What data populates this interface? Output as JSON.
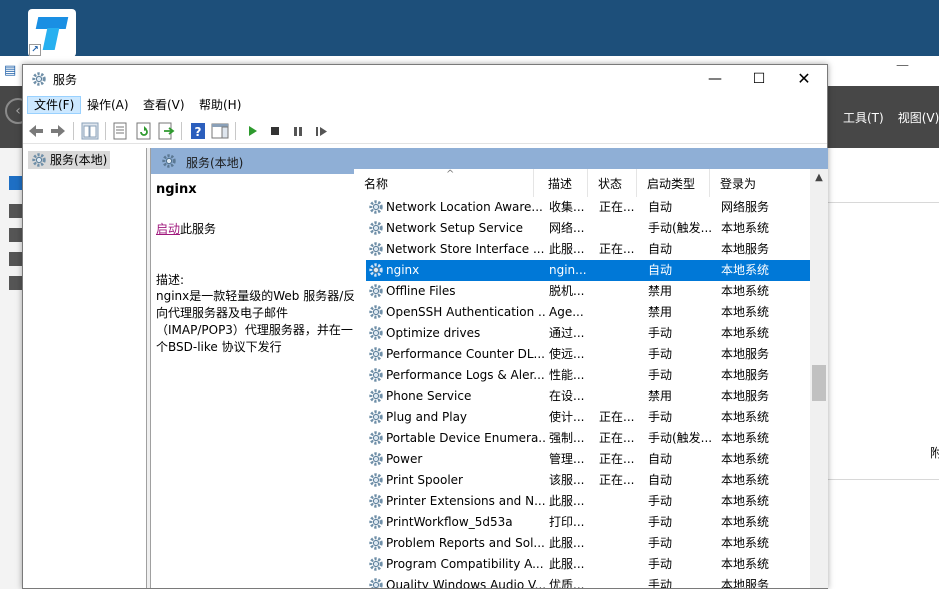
{
  "desktop": {
    "shortcut_icon": "app-shortcut-icon"
  },
  "background_app": {
    "menu": [
      "工具(T)",
      "视图(V)"
    ],
    "right_char": "附"
  },
  "window": {
    "title": "服务",
    "controls": {
      "minimize": "—",
      "maximize": "☐",
      "close": "✕"
    },
    "menu": [
      "文件(F)",
      "操作(A)",
      "查看(V)",
      "帮助(H)"
    ],
    "active_menu_index": 0,
    "toolbar_icons": [
      "back-arrow-icon",
      "forward-arrow-icon",
      "show-hide-console-tree-icon",
      "properties-icon",
      "refresh-icon",
      "export-list-icon",
      "help-icon",
      "action-pane-icon",
      "start-service-icon",
      "stop-service-icon",
      "pause-service-icon",
      "restart-service-icon"
    ]
  },
  "tree": {
    "item": "服务(本地)"
  },
  "main": {
    "header": "服务(本地)",
    "description": {
      "service_name": "nginx",
      "action_link": "启动",
      "action_suffix": "此服务",
      "label": "描述:",
      "text": "nginx是一款轻量级的Web 服务器/反向代理服务器及电子邮件（IMAP/POP3）代理服务器，并在一个BSD-like 协议下发行"
    },
    "columns": [
      "名称",
      "描述",
      "状态",
      "启动类型",
      "登录为"
    ],
    "rows": [
      {
        "name": "Network Location Aware...",
        "desc": "收集...",
        "status": "正在...",
        "start": "自动",
        "logon": "网络服务"
      },
      {
        "name": "Network Setup Service",
        "desc": "网络...",
        "status": "",
        "start": "手动(触发...",
        "logon": "本地系统"
      },
      {
        "name": "Network Store Interface ...",
        "desc": "此服...",
        "status": "正在...",
        "start": "自动",
        "logon": "本地服务"
      },
      {
        "name": "nginx",
        "desc": "ngin...",
        "status": "",
        "start": "自动",
        "logon": "本地系统",
        "selected": true
      },
      {
        "name": "Offline Files",
        "desc": "脱机...",
        "status": "",
        "start": "禁用",
        "logon": "本地系统"
      },
      {
        "name": "OpenSSH Authentication ...",
        "desc": "Age...",
        "status": "",
        "start": "禁用",
        "logon": "本地系统"
      },
      {
        "name": "Optimize drives",
        "desc": "通过...",
        "status": "",
        "start": "手动",
        "logon": "本地系统"
      },
      {
        "name": "Performance Counter DL...",
        "desc": "使远...",
        "status": "",
        "start": "手动",
        "logon": "本地服务"
      },
      {
        "name": "Performance Logs & Aler...",
        "desc": "性能...",
        "status": "",
        "start": "手动",
        "logon": "本地服务"
      },
      {
        "name": "Phone Service",
        "desc": "在设...",
        "status": "",
        "start": "禁用",
        "logon": "本地服务"
      },
      {
        "name": "Plug and Play",
        "desc": "使计...",
        "status": "正在...",
        "start": "手动",
        "logon": "本地系统"
      },
      {
        "name": "Portable Device Enumera...",
        "desc": "强制...",
        "status": "正在...",
        "start": "手动(触发...",
        "logon": "本地系统"
      },
      {
        "name": "Power",
        "desc": "管理...",
        "status": "正在...",
        "start": "自动",
        "logon": "本地系统"
      },
      {
        "name": "Print Spooler",
        "desc": "该服...",
        "status": "正在...",
        "start": "自动",
        "logon": "本地系统"
      },
      {
        "name": "Printer Extensions and N...",
        "desc": "此服...",
        "status": "",
        "start": "手动",
        "logon": "本地系统"
      },
      {
        "name": "PrintWorkflow_5d53a",
        "desc": "打印...",
        "status": "",
        "start": "手动",
        "logon": "本地系统"
      },
      {
        "name": "Problem Reports and Sol...",
        "desc": "此服...",
        "status": "",
        "start": "手动",
        "logon": "本地系统"
      },
      {
        "name": "Program Compatibility A...",
        "desc": "此服...",
        "status": "",
        "start": "手动",
        "logon": "本地系统"
      },
      {
        "name": "Quality Windows Audio V...",
        "desc": "优质...",
        "status": "",
        "start": "手动",
        "logon": "本地服务"
      }
    ],
    "scroll_up_glyph": "▲"
  },
  "colors": {
    "selection": "#0078d7",
    "header_band": "#8fafd6",
    "link": "#a0187d"
  }
}
